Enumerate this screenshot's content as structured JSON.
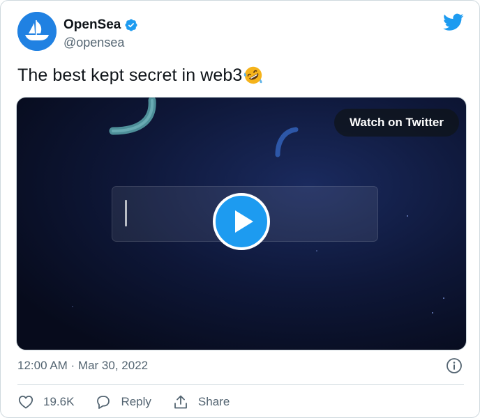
{
  "author": {
    "name": "OpenSea",
    "handle": "@opensea",
    "avatar_icon": "opensea-ship-logo",
    "verified_icon": "verified-badge-icon",
    "brand_color": "#2081e2"
  },
  "header": {
    "logo_icon": "twitter-bird-icon",
    "logo_color": "#1d9bf0"
  },
  "tweet": {
    "text": "The best kept secret in web3",
    "emoji": "rolling-on-floor-laughing"
  },
  "media": {
    "watch_label": "Watch on Twitter",
    "play_icon": "play-icon",
    "play_color": "#1d9bf0"
  },
  "meta": {
    "timestamp": "12:00 AM · Mar 30, 2022",
    "info_icon": "info-icon"
  },
  "actions": {
    "like_count": "19.6K",
    "reply_label": "Reply",
    "share_label": "Share"
  }
}
